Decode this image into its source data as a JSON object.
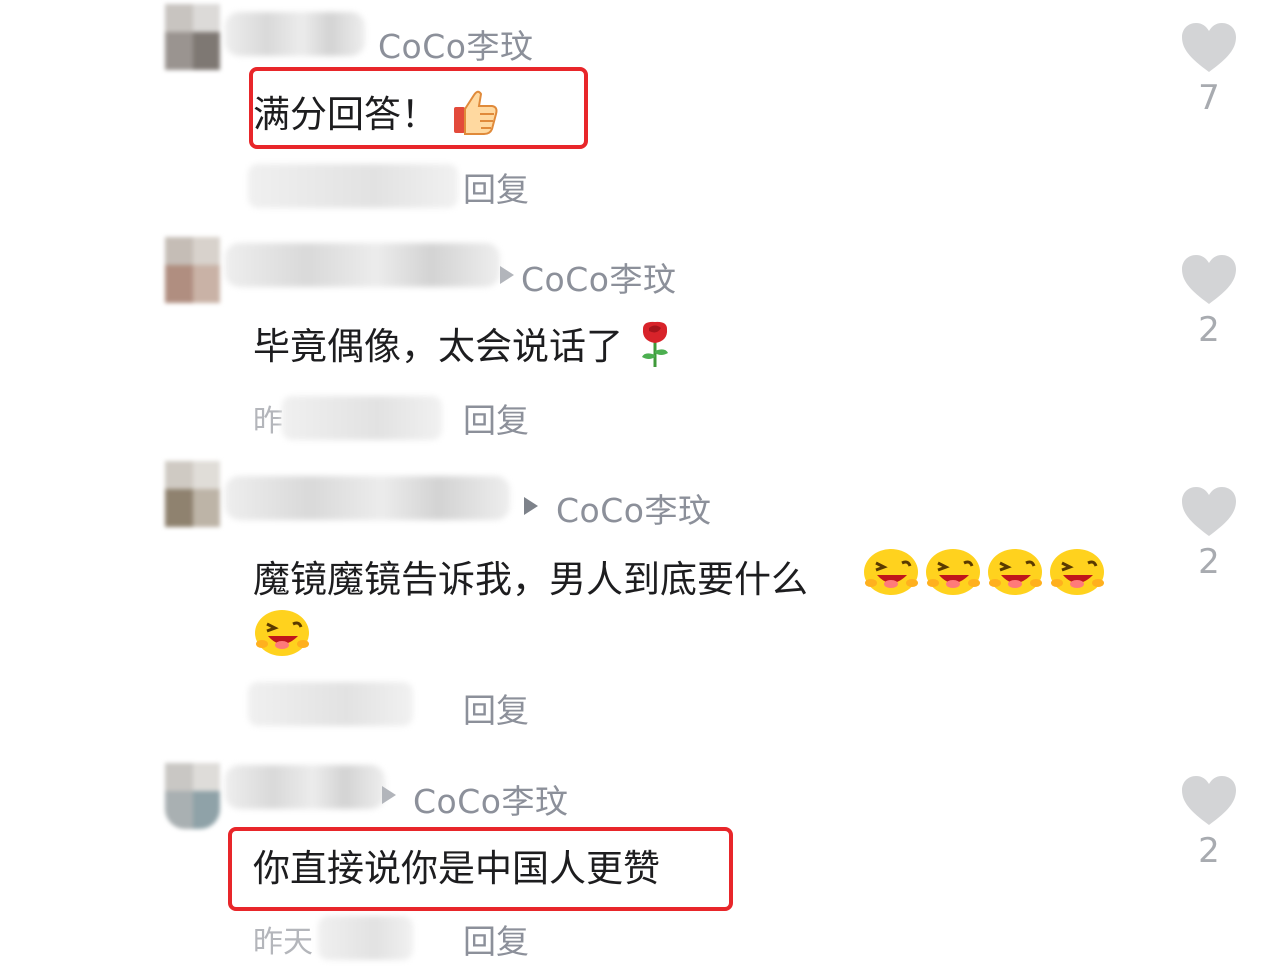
{
  "comments": [
    {
      "author": "CoCo李玟",
      "text": "满分回答！",
      "emoji": "thumbs-up",
      "time": "",
      "reply_label": "回复",
      "likes": "7"
    },
    {
      "author": "CoCo李玟",
      "text": "毕竟偶像，太会说话了",
      "emoji": "rose",
      "time": "昨",
      "reply_label": "回复",
      "likes": "2"
    },
    {
      "author": "CoCo李玟",
      "text": "魔镜魔镜告诉我，男人到底要什么",
      "emoji": "laughing-face",
      "time": "",
      "reply_label": "回复",
      "likes": "2"
    },
    {
      "author": "CoCo李玟",
      "text": "你直接说你是中国人更赞",
      "emoji": "",
      "time": "昨天",
      "reply_label": "回复",
      "likes": "2"
    }
  ],
  "colors": {
    "highlight": "#e8262a",
    "author": "#8c909a",
    "heart": "#d3d4d6"
  }
}
